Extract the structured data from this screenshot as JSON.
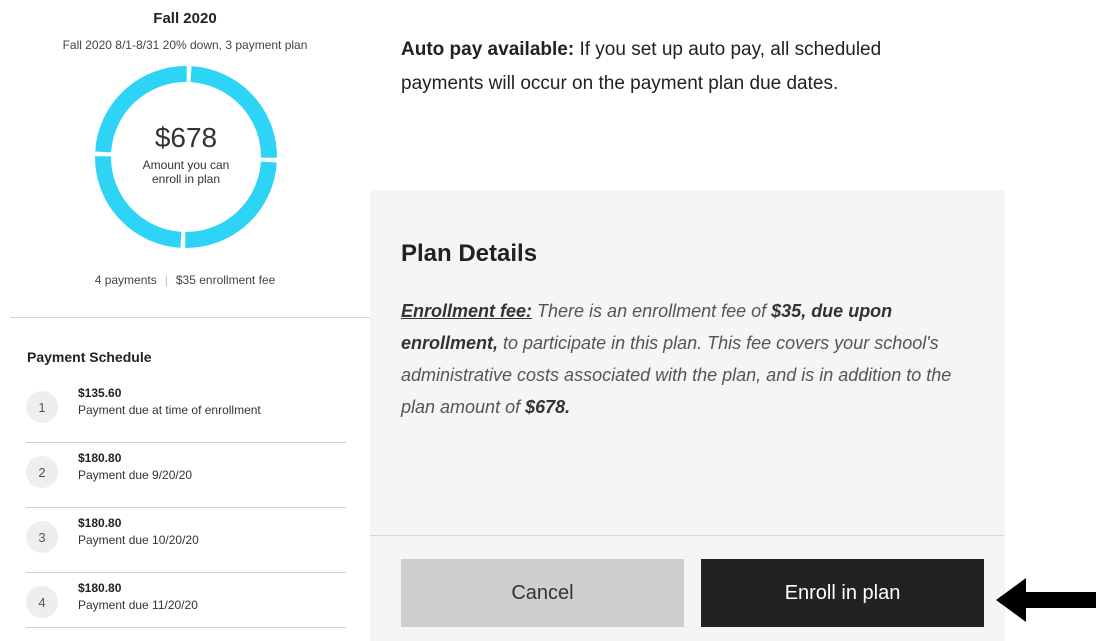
{
  "plan": {
    "title": "Fall 2020",
    "subtitle": "Fall 2020 8/1-8/31 20% down, 3 payment plan",
    "amount": "$678",
    "amount_caption": "Amount you can enroll in plan",
    "payments_count": "4 payments",
    "separator": "|",
    "enrollment_fee": "$35 enrollment fee",
    "progress": {
      "segments": 4,
      "completed_segments": 4
    }
  },
  "schedule": {
    "title": "Payment Schedule",
    "items": [
      {
        "step": "1",
        "amount": "$135.60",
        "desc": "Payment due at time of enrollment"
      },
      {
        "step": "2",
        "amount": "$180.80",
        "desc": "Payment due 9/20/20"
      },
      {
        "step": "3",
        "amount": "$180.80",
        "desc": "Payment due 10/20/20"
      },
      {
        "step": "4",
        "amount": "$180.80",
        "desc": "Payment due 11/20/20"
      }
    ]
  },
  "autopay": {
    "label": "Auto pay available:",
    "text": " If you set up auto pay, all scheduled payments will occur on the payment plan due dates."
  },
  "details": {
    "title": "Plan Details",
    "fee_label": "Enrollment fee:",
    "text1": " There is an enrollment fee of ",
    "fee_bold": "$35, due upon enrollment,",
    "text2": " to participate in this plan. This fee covers your school's administrative costs associated with the plan, and is in addition to the plan amount of ",
    "amount_bold": "$678."
  },
  "actions": {
    "cancel_label": "Cancel",
    "enroll_label": "Enroll in plan"
  },
  "colors": {
    "donut": "#2dd4f5",
    "enroll_bg": "#222222",
    "cancel_bg": "#cfcfcf",
    "panel_bg": "#f5f5f5"
  },
  "icons": {
    "arrow": "arrow-left-icon"
  }
}
